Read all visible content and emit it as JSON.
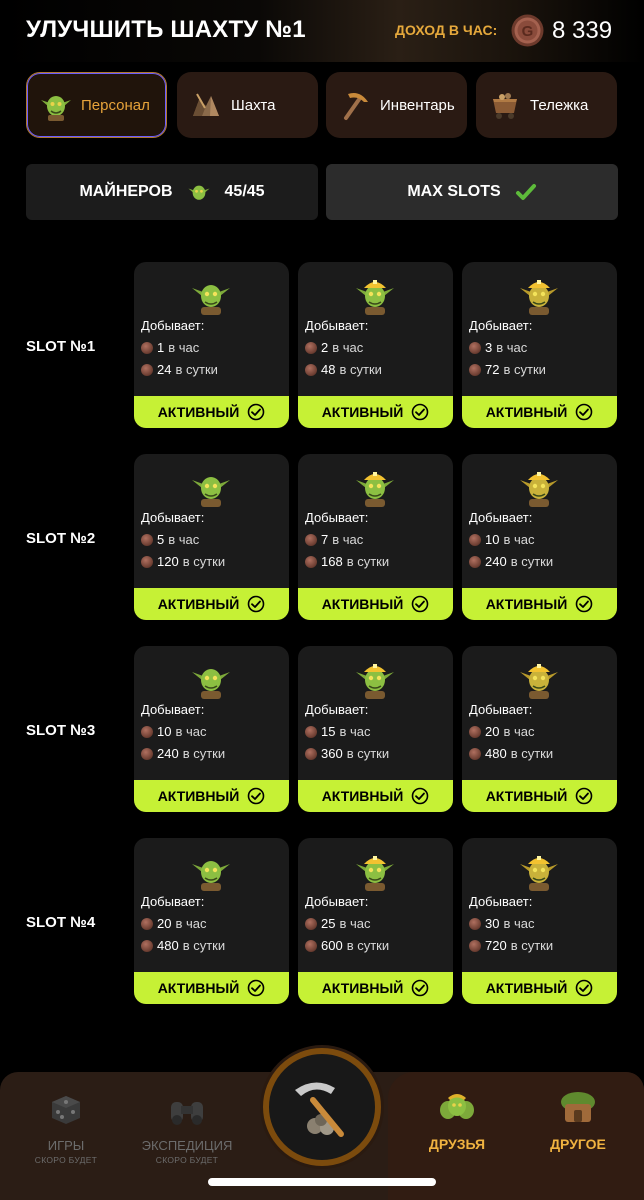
{
  "header": {
    "title": "УЛУЧШИТЬ ШАХТУ №1",
    "income_label": "ДОХОД В ЧАС:",
    "income_value": "8 339",
    "coin_icon": "copper-coin-icon"
  },
  "tabs": [
    {
      "label": "Персонал",
      "icon": "goblin-icon",
      "active": true
    },
    {
      "label": "Шахта",
      "icon": "ore-pile-icon",
      "active": false
    },
    {
      "label": "Инвентарь",
      "icon": "pickaxe-icon",
      "active": false
    },
    {
      "label": "Тележка",
      "icon": "mine-cart-icon",
      "active": false
    }
  ],
  "stats": {
    "miners_label": "МАЙНЕРОВ",
    "miners_value": "45/45",
    "max_slots_label": "MAX SLOTS"
  },
  "slots": [
    {
      "label": "SLOT №1",
      "cards": [
        {
          "mines_label": "Добывает:",
          "per_hour": "1",
          "per_hour_unit": "в час",
          "per_day": "24",
          "per_day_unit": "в сутки",
          "status": "АКТИВНЫЙ"
        },
        {
          "mines_label": "Добывает:",
          "per_hour": "2",
          "per_hour_unit": "в час",
          "per_day": "48",
          "per_day_unit": "в сутки",
          "status": "АКТИВНЫЙ"
        },
        {
          "mines_label": "Добывает:",
          "per_hour": "3",
          "per_hour_unit": "в час",
          "per_day": "72",
          "per_day_unit": "в сутки",
          "status": "АКТИВНЫЙ"
        }
      ]
    },
    {
      "label": "SLOT №2",
      "cards": [
        {
          "mines_label": "Добывает:",
          "per_hour": "5",
          "per_hour_unit": "в час",
          "per_day": "120",
          "per_day_unit": "в сутки",
          "status": "АКТИВНЫЙ"
        },
        {
          "mines_label": "Добывает:",
          "per_hour": "7",
          "per_hour_unit": "в час",
          "per_day": "168",
          "per_day_unit": "в сутки",
          "status": "АКТИВНЫЙ"
        },
        {
          "mines_label": "Добывает:",
          "per_hour": "10",
          "per_hour_unit": "в час",
          "per_day": "240",
          "per_day_unit": "в сутки",
          "status": "АКТИВНЫЙ"
        }
      ]
    },
    {
      "label": "SLOT №3",
      "cards": [
        {
          "mines_label": "Добывает:",
          "per_hour": "10",
          "per_hour_unit": "в час",
          "per_day": "240",
          "per_day_unit": "в сутки",
          "status": "АКТИВНЫЙ"
        },
        {
          "mines_label": "Добывает:",
          "per_hour": "15",
          "per_hour_unit": "в час",
          "per_day": "360",
          "per_day_unit": "в сутки",
          "status": "АКТИВНЫЙ"
        },
        {
          "mines_label": "Добывает:",
          "per_hour": "20",
          "per_hour_unit": "в час",
          "per_day": "480",
          "per_day_unit": "в сутки",
          "status": "АКТИВНЫЙ"
        }
      ]
    },
    {
      "label": "SLOT №4",
      "cards": [
        {
          "mines_label": "Добывает:",
          "per_hour": "20",
          "per_hour_unit": "в час",
          "per_day": "480",
          "per_day_unit": "в сутки",
          "status": "АКТИВНЫЙ"
        },
        {
          "mines_label": "Добывает:",
          "per_hour": "25",
          "per_hour_unit": "в час",
          "per_day": "600",
          "per_day_unit": "в сутки",
          "status": "АКТИВНЫЙ"
        },
        {
          "mines_label": "Добывает:",
          "per_hour": "30",
          "per_hour_unit": "в час",
          "per_day": "720",
          "per_day_unit": "в сутки",
          "status": "АКТИВНЫЙ"
        }
      ]
    }
  ],
  "nav": {
    "games_label": "ИГРЫ",
    "games_sub": "СКОРО БУДЕТ",
    "expedition_label": "ЭКСПЕДИЦИЯ",
    "expedition_sub": "СКОРО БУДЕТ",
    "friends_label": "ДРУЗЬЯ",
    "other_label": "ДРУГОЕ"
  },
  "colors": {
    "accent_gold": "#e6a93c",
    "active_green": "#c6f135",
    "tab_bg": "#2a1a13",
    "card_bg": "#1b1b1b"
  }
}
